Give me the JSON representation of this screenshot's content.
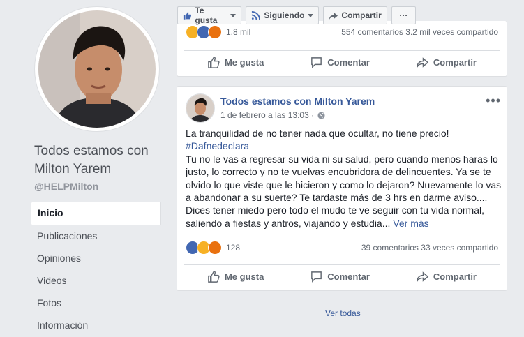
{
  "profile": {
    "name": "Todos estamos con Milton Yarem",
    "handle": "@HELPMilton"
  },
  "nav": [
    {
      "label": "Inicio",
      "active": true
    },
    {
      "label": "Publicaciones"
    },
    {
      "label": "Opiniones"
    },
    {
      "label": "Videos"
    },
    {
      "label": "Fotos"
    },
    {
      "label": "Información"
    }
  ],
  "topbar": {
    "like": "Te gusta",
    "follow": "Siguiendo",
    "share": "Compartir",
    "more": "···"
  },
  "prev_post": {
    "reaction_count": "1.8 mil",
    "comments": "554 comentarios",
    "shares": "3.2 mil veces compartido",
    "actions": {
      "like": "Me gusta",
      "comment": "Comentar",
      "share": "Compartir"
    }
  },
  "post": {
    "author": "Todos estamos con Milton Yarem",
    "date": "1 de febrero a las 13:03 ·",
    "menu": "•••",
    "line1": "La tranquilidad de no tener nada que ocultar, no tiene precio!",
    "hashtag": "#Dafnedeclara",
    "body": "Tu no le vas a regresar su vida ni su salud, pero cuando menos haras lo justo, lo correcto y no te vuelvas encubridora de delincuentes. Ya se te olvido lo que viste que le hicieron y como lo dejaron? Nuevamente lo vas a abandonar a su suerte? Te tardaste más de 3 hrs en darme aviso.... Dices tener miedo pero todo el mudo te ve seguir con tu vida normal, saliendo a fiestas y antros, viajando y estudia...",
    "see_more": "Ver más",
    "reaction_count": "128",
    "comments": "39 comentarios",
    "shares": "33 veces compartido",
    "actions": {
      "like": "Me gusta",
      "comment": "Comentar",
      "share": "Compartir"
    }
  },
  "see_all": "Ver todas",
  "colors": {
    "link": "#365899",
    "like_blue": "#4267b2",
    "bg": "#e9ebee"
  }
}
